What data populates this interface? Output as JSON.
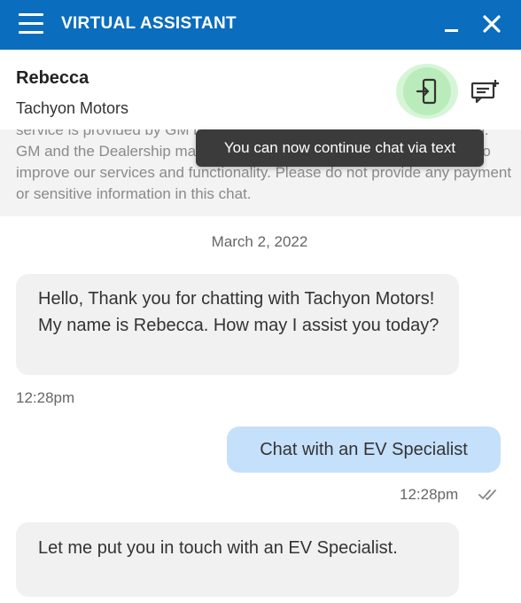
{
  "window": {
    "title": "VIRTUAL ASSISTANT",
    "brand_color": "#0a6dbd"
  },
  "header": {
    "agent_name": "Rebecca",
    "agent_company": "Tachyon Motors",
    "switch_icon": "phone-arrow-icon",
    "transcript_icon": "message-add-icon"
  },
  "disclaimer": {
    "text": "service is provided by GM in an effort to connect you to the Dealership. GM and the Dealership may use the information provided in this chat to improve our services and functionality. Please do not provide any payment or sensitive information in this chat."
  },
  "tooltip": {
    "text": "You can now continue chat via text"
  },
  "conversation": {
    "date": "March 2, 2022",
    "messages": [
      {
        "sender": "agent",
        "text": "Hello, Thank you for chatting with Tachyon Motors! My name is Rebecca. How may I assist you today?",
        "time": "12:28pm"
      },
      {
        "sender": "user",
        "text": "Chat with an EV Specialist",
        "time": "12:28pm",
        "status_icon": "double-check-icon"
      },
      {
        "sender": "agent",
        "text": "Let me put you in touch with an EV Specialist."
      }
    ]
  }
}
